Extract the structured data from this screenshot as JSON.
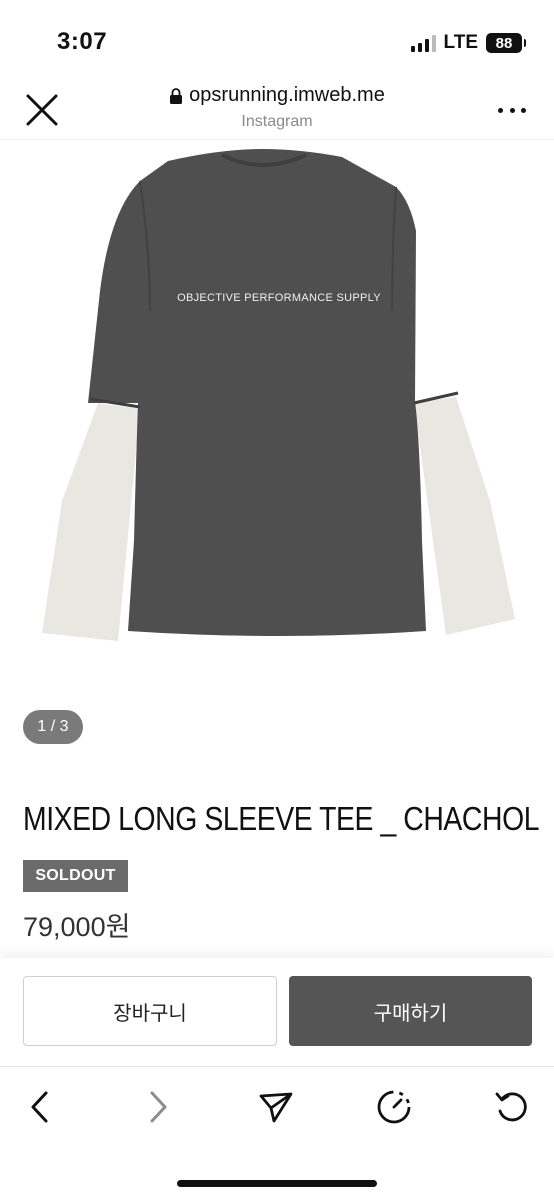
{
  "status_bar": {
    "time": "3:07",
    "network": "LTE",
    "battery": "88"
  },
  "browser": {
    "url": "opsrunning.imweb.me",
    "subtitle": "Instagram",
    "icons": [
      "close-icon",
      "lock-icon",
      "more-icon"
    ]
  },
  "product_image": {
    "print_text": "OBJECTIVE PERFORMANCE SUPPLY",
    "body_color": "#505050",
    "sleeve_color": "#e9e7e2"
  },
  "gallery": {
    "counter": "1 / 3"
  },
  "product": {
    "title": "MIXED LONG SLEEVE TEE _ CHACHOL",
    "badge": "SOLDOUT",
    "price": "79,000원"
  },
  "actions": {
    "cart_label": "장바구니",
    "buy_label": "구매하기"
  },
  "toolbar": {
    "icons": [
      "back-icon",
      "forward-icon",
      "share-icon",
      "timer-icon",
      "reload-icon"
    ]
  },
  "colors": {
    "button_dark": "#555555",
    "badge": "#6b6b6b"
  }
}
